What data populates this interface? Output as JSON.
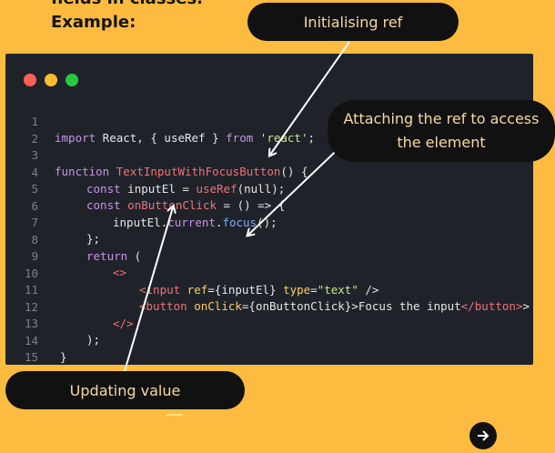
{
  "header": {
    "partial_text": "fields in classes.",
    "example_label": "Example:"
  },
  "callouts": {
    "initialising_ref": "Initialising ref",
    "attaching_ref_line1": "Attaching the ref to access",
    "attaching_ref_line2": "the element",
    "updating_value": "Updating value"
  },
  "code": {
    "lines": [
      {
        "n": "1"
      },
      {
        "n": "2"
      },
      {
        "n": "3"
      },
      {
        "n": "4"
      },
      {
        "n": "5"
      },
      {
        "n": "6"
      },
      {
        "n": "7"
      },
      {
        "n": "8"
      },
      {
        "n": "9"
      },
      {
        "n": "10"
      },
      {
        "n": "11"
      },
      {
        "n": "12"
      },
      {
        "n": "13"
      },
      {
        "n": "14"
      },
      {
        "n": "15"
      }
    ],
    "t": {
      "l1_import": "import",
      "l1_a": " React, { useRef } ",
      "l1_from": "from",
      "l1_str": "'react'",
      "l1_end": ";",
      "l3_function": "function",
      "l3_name": "TextInputWithFocusButton",
      "l3_end": "() {",
      "l4_const": "const",
      "l4_a": " inputEl = ",
      "l4_fn": "useRef",
      "l4_end": "(null);",
      "l5_const": "const",
      "l5_name": " onButtonClick",
      "l5_end": " = () => {",
      "l6_a": "inputEl.",
      "l6_b": "current",
      "l6_c": ".",
      "l6_fn": "focus",
      "l6_end": "();",
      "l7": "};",
      "l8_return": "return",
      "l8_end": " (",
      "l9": "<>",
      "l10_open": "<input",
      "l10_attr": " ref",
      "l10_a": "={inputEl} ",
      "l10_attr2": "type",
      "l10_eq": "=",
      "l10_str": "\"text\"",
      "l10_close": " />",
      "l11_open": "<button",
      "l11_attr": " onClick",
      "l11_a": "={onButtonClick}>",
      "l11_text": "Focus the input",
      "l11_close": "</button>",
      "l11_gt": ">",
      "l12": "</>",
      "l13": ");",
      "l14": "}"
    }
  },
  "controls": {
    "next_icon": "arrow-right-icon"
  },
  "colors": {
    "background": "#FDBB3F",
    "editor_bg": "#1F2329",
    "callout_bg": "#111111",
    "callout_text": "#F7D9A3"
  }
}
